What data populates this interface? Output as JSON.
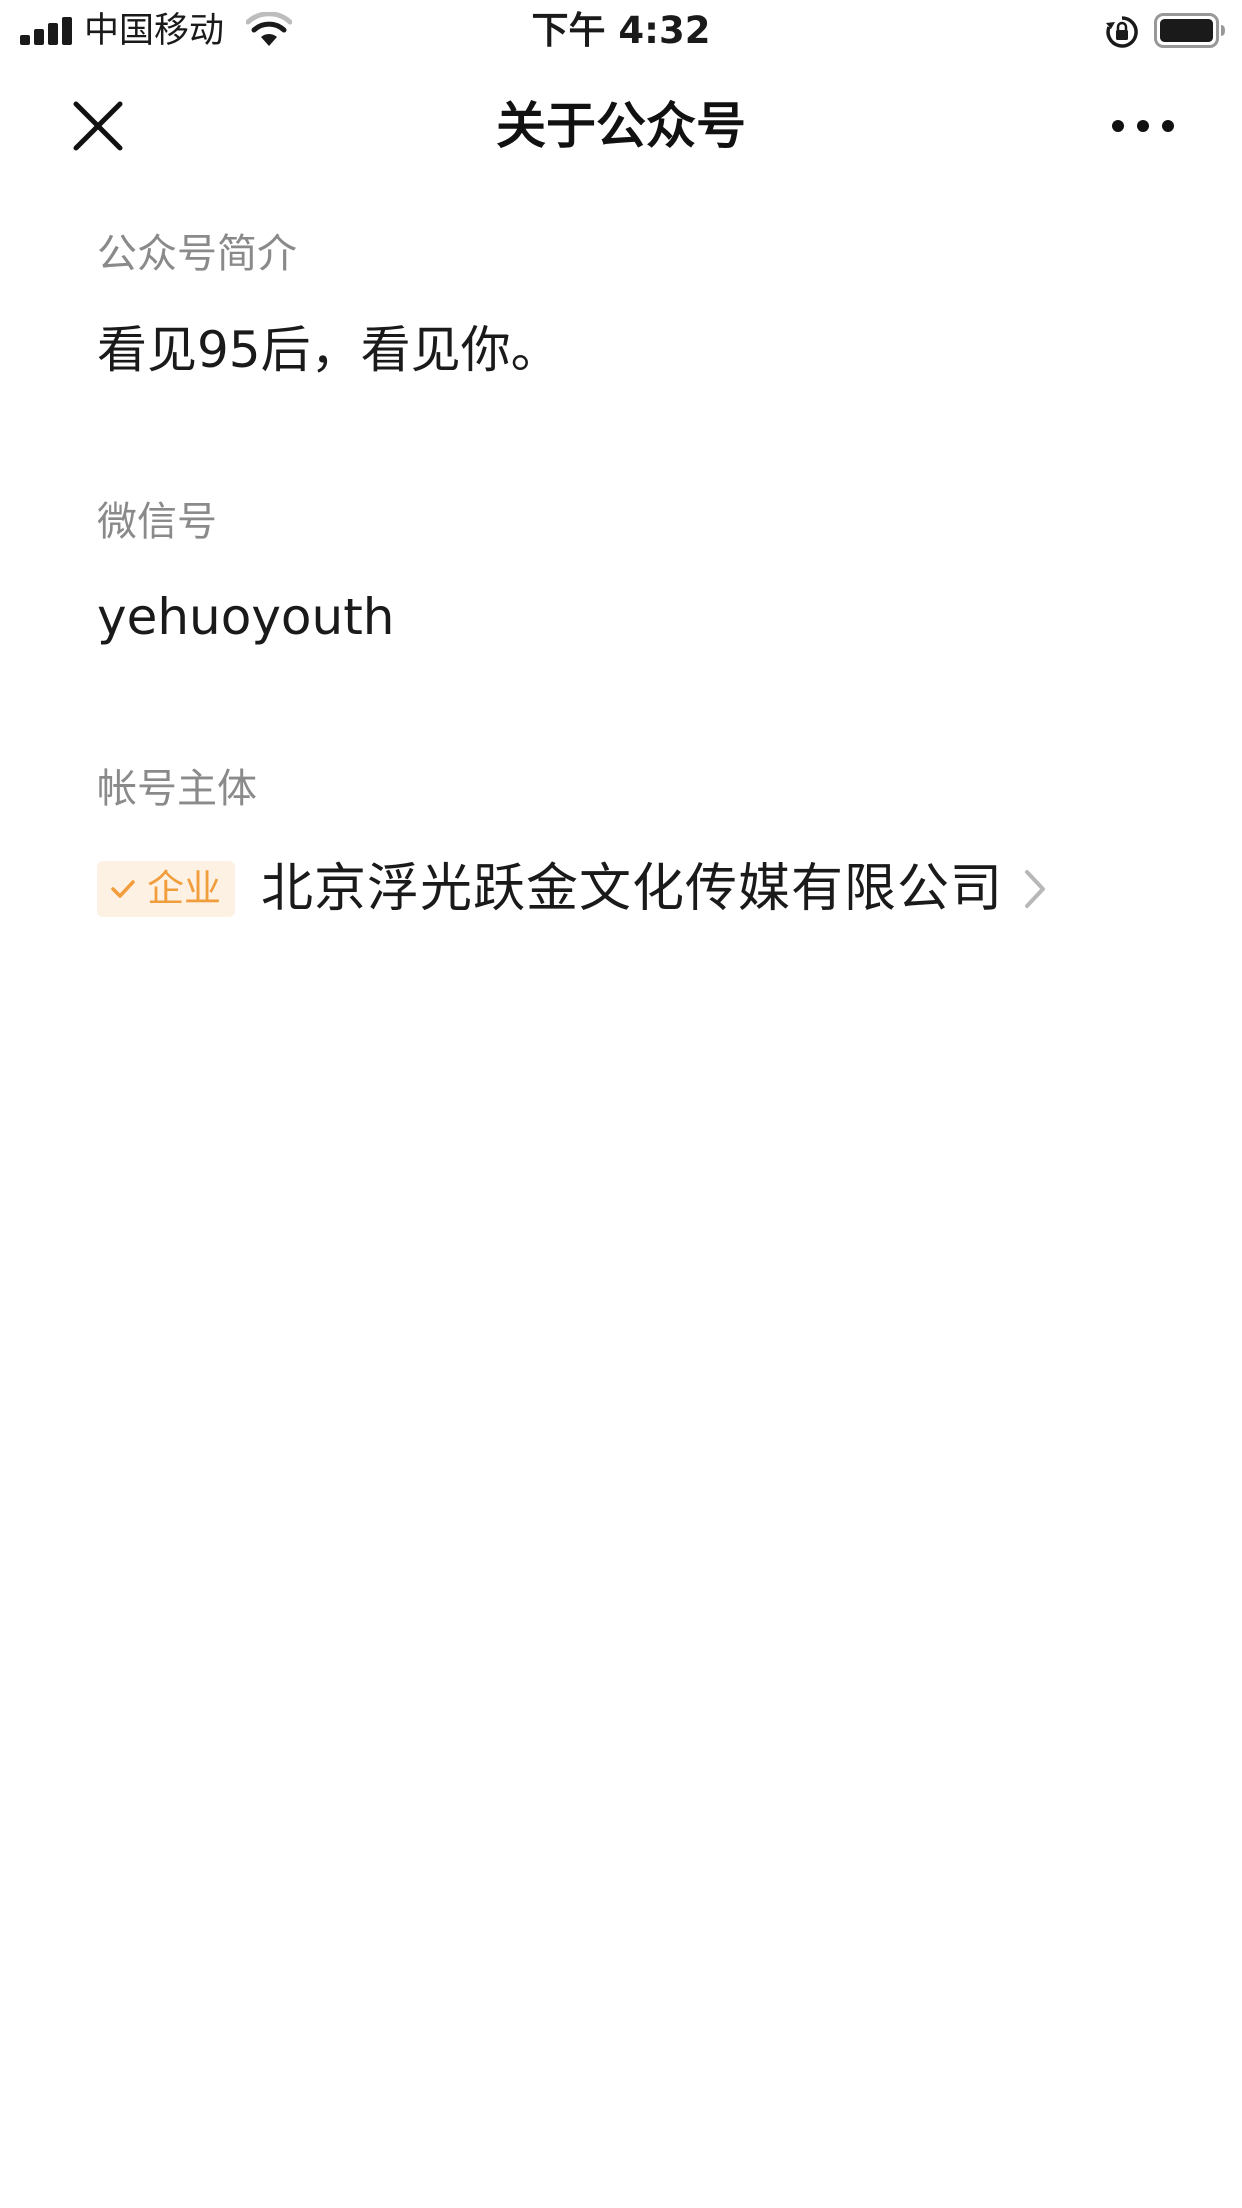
{
  "status_bar": {
    "carrier": "中国移动",
    "time": "下午 4:32",
    "signal_icon": "signal-bars-icon",
    "wifi_icon": "wifi-icon",
    "orientation_lock_icon": "orientation-lock-icon",
    "battery_icon": "battery-icon"
  },
  "nav": {
    "title": "关于公众号",
    "close_icon": "close-icon",
    "more_icon": "more-icon"
  },
  "intro": {
    "label": "公众号简介",
    "value": "看见95后，看见你。"
  },
  "wechat_id": {
    "label": "微信号",
    "value": "yehuoyouth"
  },
  "entity": {
    "label": "帐号主体",
    "badge": "企业",
    "name": "北京浮光跃金文化传媒有限公司",
    "chevron_icon": "chevron-right-icon"
  },
  "colors": {
    "badge_text": "#f19d3b",
    "badge_bg": "#fdf1e4",
    "label_gray": "#8a8a8a",
    "text_dark": "#1a1a1a"
  }
}
